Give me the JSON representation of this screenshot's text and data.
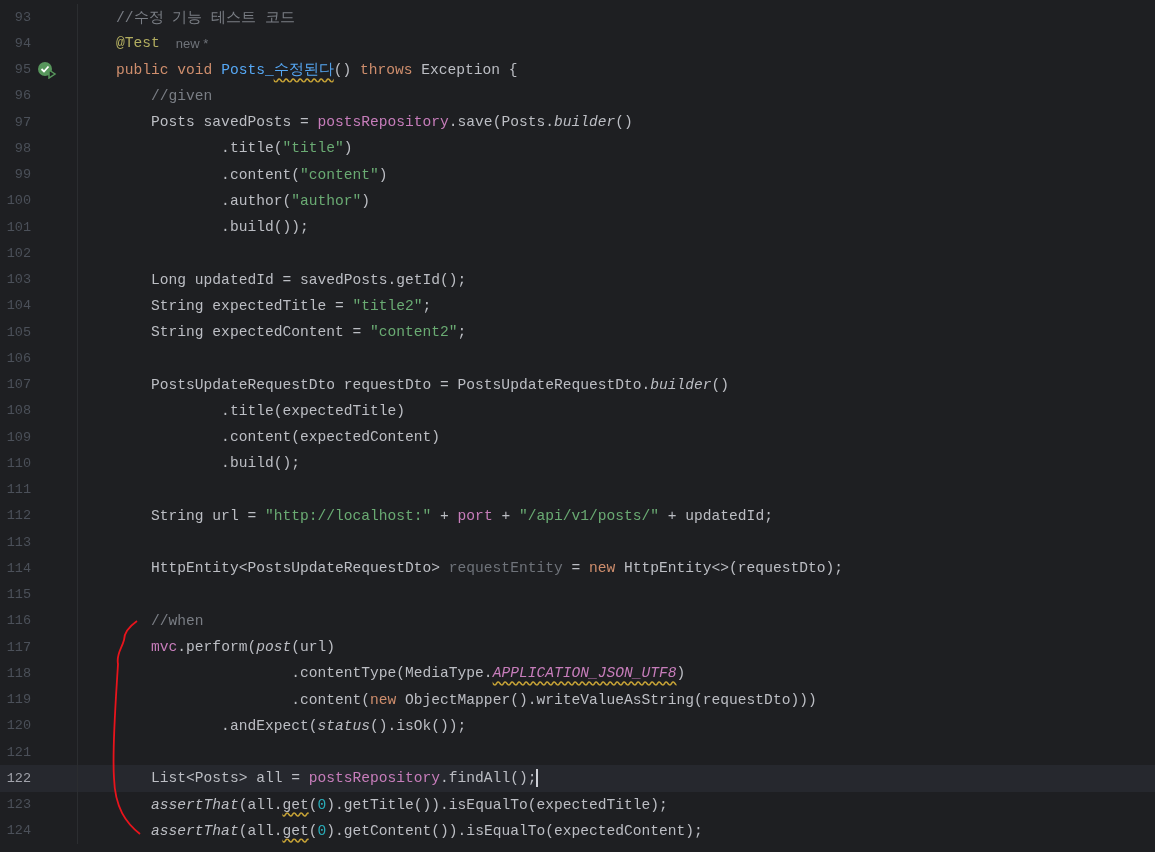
{
  "editor": {
    "lines": [
      {
        "number": "93",
        "current": false,
        "runnable": false,
        "tokens": [
          {
            "text": "    //수정 기능 테스트 코드",
            "kind": "comment"
          }
        ]
      },
      {
        "number": "94",
        "current": false,
        "runnable": false,
        "tokens": [
          {
            "text": "    @Test",
            "kind": "annotation"
          },
          {
            "text": "new *",
            "kind": "hint"
          }
        ]
      },
      {
        "number": "95",
        "current": false,
        "runnable": true,
        "tokens": [
          {
            "text": "    public",
            "kind": "keyword"
          },
          {
            "text": " void",
            "kind": "keyword"
          },
          {
            "text": " Posts_",
            "kind": "declaration"
          },
          {
            "text": "수정된다",
            "kind": "declaration-warn"
          },
          {
            "text": "() ",
            "kind": "plain"
          },
          {
            "text": "throws",
            "kind": "keyword"
          },
          {
            "text": " Exception {",
            "kind": "plain"
          }
        ]
      },
      {
        "number": "96",
        "current": false,
        "runnable": false,
        "tokens": [
          {
            "text": "        //given",
            "kind": "comment"
          }
        ]
      },
      {
        "number": "97",
        "current": false,
        "runnable": false,
        "tokens": [
          {
            "text": "        Posts savedPosts = ",
            "kind": "plain"
          },
          {
            "text": "postsRepository",
            "kind": "field"
          },
          {
            "text": ".save(Posts.",
            "kind": "plain"
          },
          {
            "text": "builder",
            "kind": "static"
          },
          {
            "text": "()",
            "kind": "plain"
          }
        ]
      },
      {
        "number": "98",
        "current": false,
        "runnable": false,
        "tokens": [
          {
            "text": "                .title(",
            "kind": "plain"
          },
          {
            "text": "\"title\"",
            "kind": "string"
          },
          {
            "text": ")",
            "kind": "plain"
          }
        ]
      },
      {
        "number": "99",
        "current": false,
        "runnable": false,
        "tokens": [
          {
            "text": "                .content(",
            "kind": "plain"
          },
          {
            "text": "\"content\"",
            "kind": "string"
          },
          {
            "text": ")",
            "kind": "plain"
          }
        ]
      },
      {
        "number": "100",
        "current": false,
        "runnable": false,
        "tokens": [
          {
            "text": "                .author(",
            "kind": "plain"
          },
          {
            "text": "\"author\"",
            "kind": "string"
          },
          {
            "text": ")",
            "kind": "plain"
          }
        ]
      },
      {
        "number": "101",
        "current": false,
        "runnable": false,
        "tokens": [
          {
            "text": "                .build());",
            "kind": "plain"
          }
        ]
      },
      {
        "number": "102",
        "current": false,
        "runnable": false
      },
      {
        "number": "103",
        "current": false,
        "runnable": false,
        "tokens": [
          {
            "text": "        Long updatedId = savedPosts.getId();",
            "kind": "plain"
          }
        ]
      },
      {
        "number": "104",
        "current": false,
        "runnable": false,
        "tokens": [
          {
            "text": "        String expectedTitle = ",
            "kind": "plain"
          },
          {
            "text": "\"title2\"",
            "kind": "string"
          },
          {
            "text": ";",
            "kind": "plain"
          }
        ]
      },
      {
        "number": "105",
        "current": false,
        "runnable": false,
        "tokens": [
          {
            "text": "        String expectedContent = ",
            "kind": "plain"
          },
          {
            "text": "\"content2\"",
            "kind": "string"
          },
          {
            "text": ";",
            "kind": "plain"
          }
        ]
      },
      {
        "number": "106",
        "current": false,
        "runnable": false
      },
      {
        "number": "107",
        "current": false,
        "runnable": false,
        "tokens": [
          {
            "text": "        PostsUpdateRequestDto requestDto = PostsUpdateRequestDto.",
            "kind": "plain"
          },
          {
            "text": "builder",
            "kind": "static"
          },
          {
            "text": "()",
            "kind": "plain"
          }
        ]
      },
      {
        "number": "108",
        "current": false,
        "runnable": false,
        "tokens": [
          {
            "text": "                .title(expectedTitle)",
            "kind": "plain"
          }
        ]
      },
      {
        "number": "109",
        "current": false,
        "runnable": false,
        "tokens": [
          {
            "text": "                .content(expectedContent)",
            "kind": "plain"
          }
        ]
      },
      {
        "number": "110",
        "current": false,
        "runnable": false,
        "tokens": [
          {
            "text": "                .build();",
            "kind": "plain"
          }
        ]
      },
      {
        "number": "111",
        "current": false,
        "runnable": false
      },
      {
        "number": "112",
        "current": false,
        "runnable": false,
        "tokens": [
          {
            "text": "        String url = ",
            "kind": "plain"
          },
          {
            "text": "\"http://localhost:\"",
            "kind": "string"
          },
          {
            "text": " + ",
            "kind": "plain"
          },
          {
            "text": "port",
            "kind": "field"
          },
          {
            "text": " + ",
            "kind": "plain"
          },
          {
            "text": "\"/api/v1/posts/\"",
            "kind": "string"
          },
          {
            "text": " + updatedId;",
            "kind": "plain"
          }
        ]
      },
      {
        "number": "113",
        "current": false,
        "runnable": false
      },
      {
        "number": "114",
        "current": false,
        "runnable": false,
        "tokens": [
          {
            "text": "        HttpEntity<PostsUpdateRequestDto> ",
            "kind": "plain"
          },
          {
            "text": "requestEntity",
            "kind": "unused"
          },
          {
            "text": " = ",
            "kind": "plain"
          },
          {
            "text": "new",
            "kind": "keyword"
          },
          {
            "text": " HttpEntity<>(requestDto);",
            "kind": "plain"
          }
        ]
      },
      {
        "number": "115",
        "current": false,
        "runnable": false
      },
      {
        "number": "116",
        "current": false,
        "runnable": false,
        "tokens": [
          {
            "text": "        //when",
            "kind": "comment"
          }
        ]
      },
      {
        "number": "117",
        "current": false,
        "runnable": false,
        "tokens": [
          {
            "text": "        mvc",
            "kind": "field"
          },
          {
            "text": ".perform(",
            "kind": "plain"
          },
          {
            "text": "post",
            "kind": "static"
          },
          {
            "text": "(url)",
            "kind": "plain"
          }
        ]
      },
      {
        "number": "118",
        "current": false,
        "runnable": false,
        "tokens": [
          {
            "text": "                        .contentType(MediaType.",
            "kind": "plain"
          },
          {
            "text": "APPLICATION_JSON_UTF8",
            "kind": "constant-warn"
          },
          {
            "text": ")",
            "kind": "plain"
          }
        ]
      },
      {
        "number": "119",
        "current": false,
        "runnable": false,
        "tokens": [
          {
            "text": "                        .content(",
            "kind": "plain"
          },
          {
            "text": "new",
            "kind": "keyword"
          },
          {
            "text": " ObjectMapper().writeValueAsString(requestDto)))",
            "kind": "plain"
          }
        ]
      },
      {
        "number": "120",
        "current": false,
        "runnable": false,
        "tokens": [
          {
            "text": "                .andExpect(",
            "kind": "plain"
          },
          {
            "text": "status",
            "kind": "static"
          },
          {
            "text": "().isOk());",
            "kind": "plain"
          }
        ]
      },
      {
        "number": "121",
        "current": false,
        "runnable": false
      },
      {
        "number": "122",
        "current": true,
        "runnable": false,
        "tokens": [
          {
            "text": "        List<Posts> all = ",
            "kind": "plain"
          },
          {
            "text": "postsRepository",
            "kind": "field"
          },
          {
            "text": ".findAll();",
            "kind": "plain"
          }
        ]
      },
      {
        "number": "123",
        "current": false,
        "runnable": false,
        "tokens": [
          {
            "text": "        assertThat",
            "kind": "static"
          },
          {
            "text": "(all.",
            "kind": "plain"
          },
          {
            "text": "get",
            "kind": "plain-warn"
          },
          {
            "text": "(",
            "kind": "plain"
          },
          {
            "text": "0",
            "kind": "number"
          },
          {
            "text": ").getTitle()).isEqualTo(expectedTitle);",
            "kind": "plain"
          }
        ]
      },
      {
        "number": "124",
        "current": false,
        "runnable": false,
        "tokens": [
          {
            "text": "        assertThat",
            "kind": "static"
          },
          {
            "text": "(all.",
            "kind": "plain"
          },
          {
            "text": "get",
            "kind": "plain-warn"
          },
          {
            "text": "(",
            "kind": "plain"
          },
          {
            "text": "0",
            "kind": "number"
          },
          {
            "text": ").getContent()).isEqualTo(expectedContent);",
            "kind": "plain"
          }
        ]
      }
    ]
  }
}
